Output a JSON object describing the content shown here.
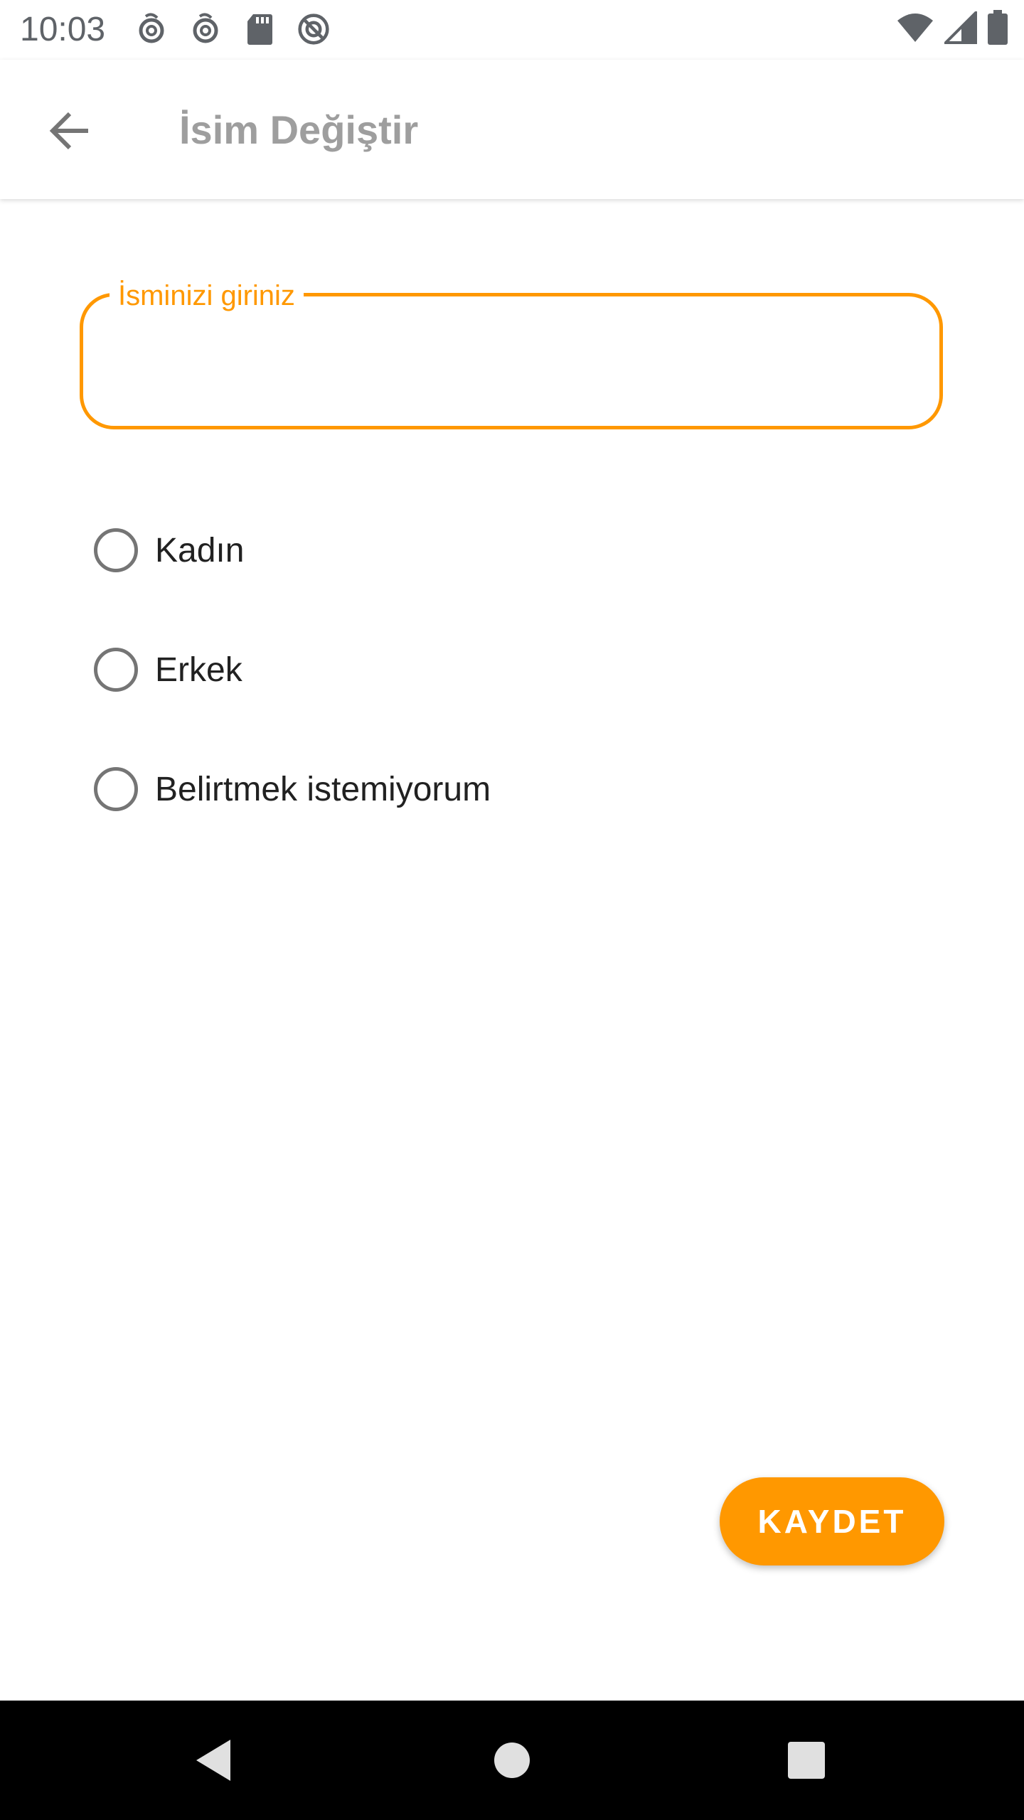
{
  "status_bar": {
    "time": "10:03",
    "left_icons": [
      "at-sign-icon",
      "at-sign-icon",
      "sd-card-icon",
      "do-not-disturb-icon"
    ],
    "right_icons": [
      "wifi-icon",
      "cellular-signal-icon",
      "battery-icon"
    ]
  },
  "app_bar": {
    "back_icon": "arrow-back-icon",
    "title": "İsim Değiştir"
  },
  "form": {
    "name_field": {
      "label": "İsminizi giriniz",
      "value": ""
    },
    "gender_options": [
      {
        "label": "Kadın",
        "selected": false
      },
      {
        "label": "Erkek",
        "selected": false
      },
      {
        "label": "Belirtmek istemiyorum",
        "selected": false
      }
    ],
    "save_label": "KAYDET"
  },
  "nav_bar": {
    "buttons": [
      "back-triangle-icon",
      "home-circle-icon",
      "recents-square-icon"
    ]
  },
  "colors": {
    "accent": "#ff9800",
    "title_gray": "#9e9e9e",
    "radio_gray": "#757575",
    "nav_bg": "#000000"
  }
}
